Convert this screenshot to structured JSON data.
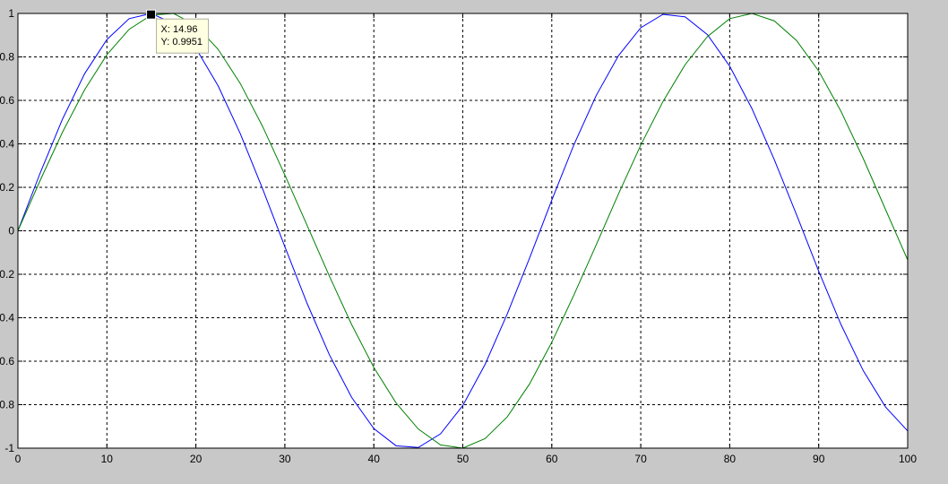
{
  "chart_data": {
    "type": "line",
    "title": "",
    "xlabel": "",
    "ylabel": "",
    "xlim": [
      0,
      100
    ],
    "ylim": [
      -1,
      1
    ],
    "xticks": [
      0,
      10,
      20,
      30,
      40,
      50,
      60,
      70,
      80,
      90,
      100
    ],
    "yticks": [
      -1,
      -0.8,
      -0.6,
      -0.4,
      -0.2,
      0,
      0.2,
      0.4,
      0.6,
      0.8,
      1
    ],
    "xtick_labels": [
      "0",
      "10",
      "20",
      "30",
      "40",
      "50",
      "60",
      "70",
      "80",
      "90",
      "100"
    ],
    "ytick_labels": [
      "-1",
      "-0.8",
      "-0.6",
      "-0.4",
      "-0.2",
      "0",
      "0.2",
      "0.4",
      "0.6",
      "0.8",
      "1"
    ],
    "grid": true,
    "series": [
      {
        "color": "#0000ff",
        "x": [
          0,
          2.5,
          5,
          7.5,
          10,
          12.5,
          15,
          17.5,
          20,
          22.5,
          25,
          27.5,
          30,
          32.5,
          35,
          37.5,
          40,
          42.5,
          45,
          47.5,
          50,
          52.5,
          55,
          57.5,
          60,
          62.5,
          65,
          67.5,
          70,
          72.5,
          75,
          77.5,
          80,
          82.5,
          85,
          87.5,
          90,
          92.5,
          95,
          97.5,
          100
        ],
        "y": [
          0,
          0.266,
          0.513,
          0.723,
          0.88,
          0.976,
          1.0,
          0.953,
          0.84,
          0.667,
          0.446,
          0.193,
          -0.073,
          -0.334,
          -0.57,
          -0.766,
          -0.91,
          -0.989,
          -0.997,
          -0.934,
          -0.804,
          -0.615,
          -0.382,
          -0.126,
          0.141,
          0.397,
          0.623,
          0.806,
          0.934,
          0.996,
          0.984,
          0.902,
          0.757,
          0.562,
          0.328,
          0.075,
          -0.186,
          -0.431,
          -0.643,
          -0.81,
          -0.921
        ]
      },
      {
        "color": "#008000",
        "x": [
          0,
          2.5,
          5,
          7.5,
          10,
          12.5,
          15,
          17.5,
          20,
          22.5,
          25,
          27.5,
          30,
          32.5,
          35,
          37.5,
          40,
          42.5,
          45,
          47.5,
          50,
          52.5,
          55,
          57.5,
          60,
          62.5,
          65,
          67.5,
          70,
          72.5,
          75,
          77.5,
          80,
          82.5,
          85,
          87.5,
          90,
          92.5,
          95,
          97.5,
          100
        ],
        "y": [
          0,
          0.232,
          0.453,
          0.649,
          0.81,
          0.927,
          0.993,
          1.0,
          0.945,
          0.835,
          0.677,
          0.48,
          0.257,
          0.025,
          -0.208,
          -0.431,
          -0.629,
          -0.792,
          -0.912,
          -0.985,
          -1.0,
          -0.956,
          -0.856,
          -0.705,
          -0.513,
          -0.294,
          -0.064,
          0.17,
          0.394,
          0.595,
          0.765,
          0.894,
          0.976,
          1.0,
          0.966,
          0.876,
          0.735,
          0.55,
          0.333,
          0.099,
          -0.134
        ]
      }
    ],
    "datatip": {
      "x_text": "X: 14.96",
      "y_text": "Y: 0.9951",
      "x": 14.96,
      "y": 0.9951
    }
  }
}
